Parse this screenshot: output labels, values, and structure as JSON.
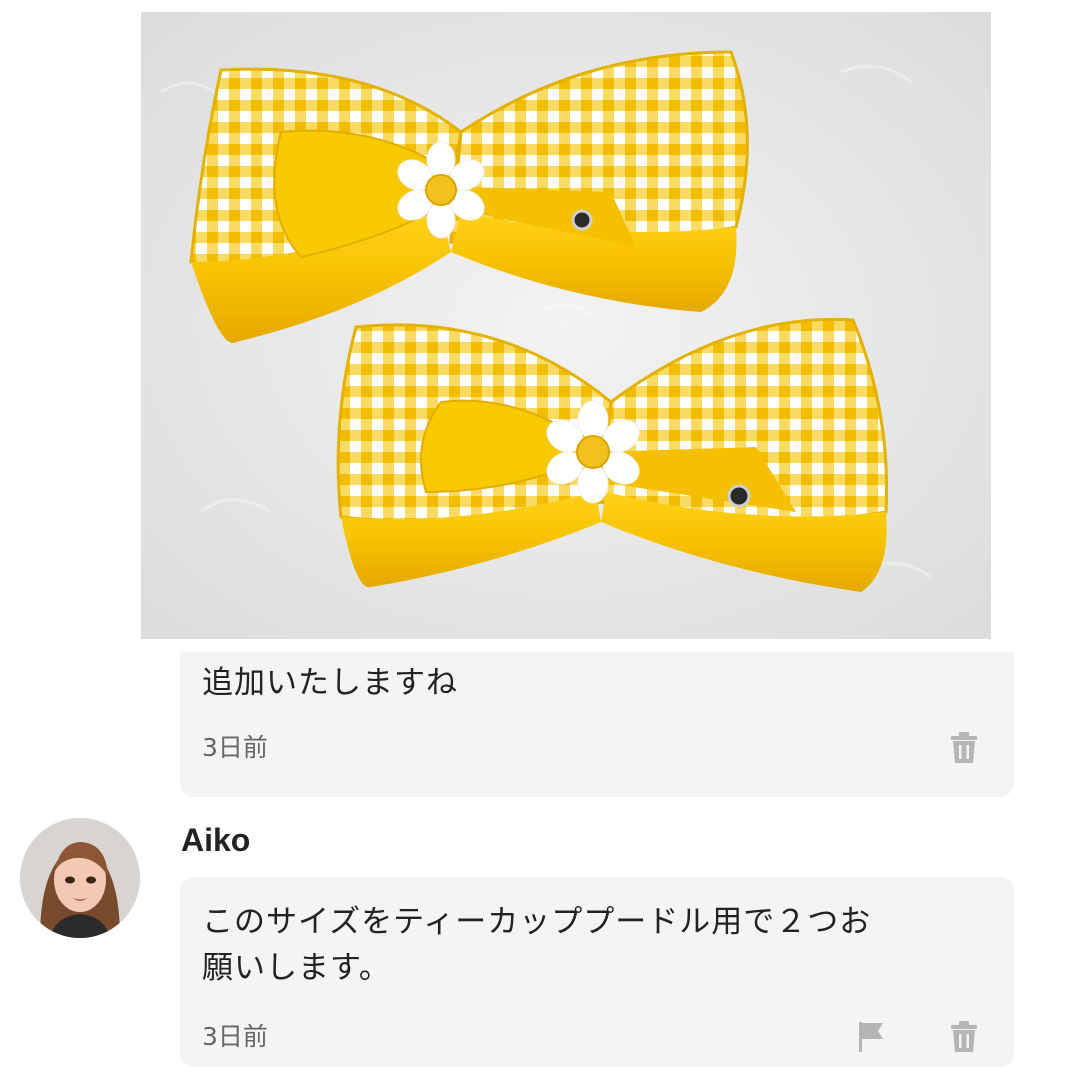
{
  "product": {
    "image_alt": "yellow gingham hair bows"
  },
  "comments": [
    {
      "text": "追加いたしますね",
      "time": "3日前",
      "actions": [
        "trash-icon"
      ]
    },
    {
      "user": "Aiko",
      "text_line1": "このサイズをティーカッププードル用で２つお",
      "text_line2": "願いします。",
      "time": "3日前",
      "actions": [
        "flag-icon",
        "trash-icon"
      ]
    }
  ],
  "colors": {
    "bubble_bg": "#f4f4f4",
    "icon_gray": "#b5b5b5",
    "bow_yellow": "#f5c400",
    "bow_dark": "#e2a900"
  }
}
